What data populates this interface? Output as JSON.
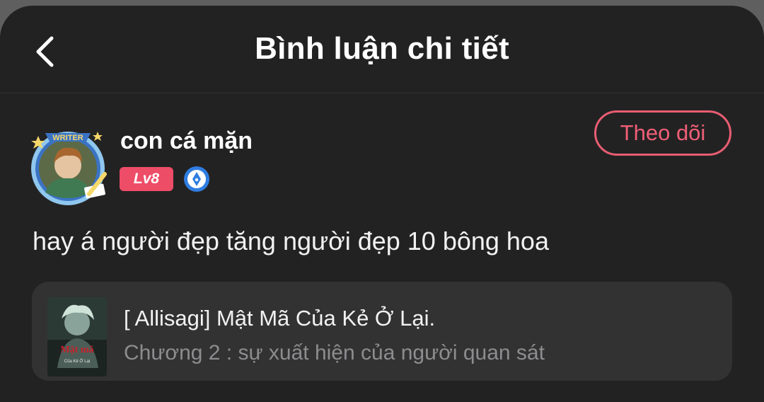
{
  "header": {
    "title": "Bình luận chi tiết",
    "back_icon": "chevron-left-icon"
  },
  "user": {
    "name": "con cá mặn",
    "level": "Lv8",
    "frame_label": "WRITER",
    "verified_icon": "pen-nib-icon",
    "follow_label": "Theo dõi"
  },
  "comment": {
    "text": "hay á người đẹp tăng người đẹp 10 bông hoa"
  },
  "story": {
    "title": "[ Allisagi] Mật Mã Của Kẻ Ở Lại.",
    "chapter": "Chương 2 : sự xuất hiện của người quan sát",
    "cover_title": "Mật mã",
    "cover_subtitle": "Của Kẻ Ở Lại"
  },
  "colors": {
    "accent": "#ee4d68",
    "background": "#232223",
    "card": "#333233",
    "text_primary": "#ffffff",
    "text_secondary": "#8d8c8e"
  }
}
